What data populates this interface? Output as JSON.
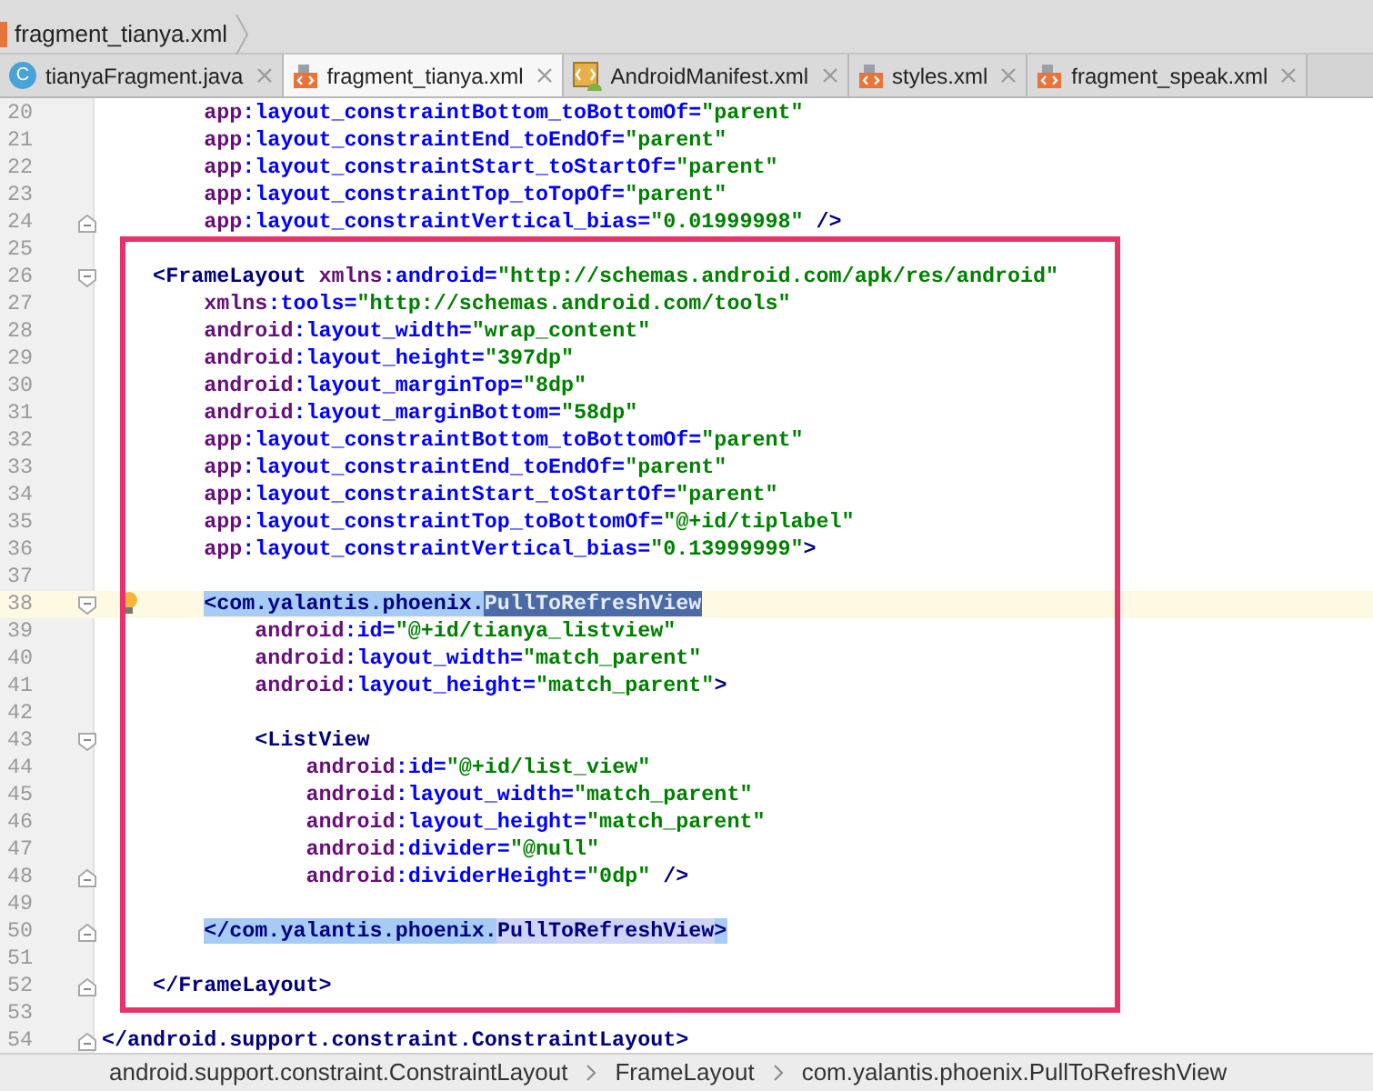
{
  "navigation_bar": {
    "file": "fragment_tianya.xml"
  },
  "tabs": [
    {
      "label": "tianyaFragment.java",
      "kind": "java",
      "icon_letter": "C",
      "selected": false
    },
    {
      "label": "fragment_tianya.xml",
      "kind": "xml",
      "selected": true
    },
    {
      "label": "AndroidManifest.xml",
      "kind": "manifest",
      "selected": false
    },
    {
      "label": "styles.xml",
      "kind": "xml",
      "selected": false
    },
    {
      "label": "fragment_speak.xml",
      "kind": "xml",
      "selected": false
    }
  ],
  "editor": {
    "lines": [
      {
        "number": "20",
        "kind": "plain",
        "current": false,
        "bulb": false,
        "tokens": [
          {
            "kind": "ns",
            "text": "        app"
          },
          {
            "kind": "attr",
            "text": ":layout_constraintBottom_toBottomOf="
          },
          {
            "kind": "value",
            "text": "\"parent\""
          }
        ]
      },
      {
        "number": "21",
        "kind": "plain",
        "current": false,
        "bulb": false,
        "tokens": [
          {
            "kind": "ns",
            "text": "        app"
          },
          {
            "kind": "attr",
            "text": ":layout_constraintEnd_toEndOf="
          },
          {
            "kind": "value",
            "text": "\"parent\""
          }
        ]
      },
      {
        "number": "22",
        "kind": "plain",
        "current": false,
        "bulb": false,
        "tokens": [
          {
            "kind": "ns",
            "text": "        app"
          },
          {
            "kind": "attr",
            "text": ":layout_constraintStart_toStartOf="
          },
          {
            "kind": "value",
            "text": "\"parent\""
          }
        ]
      },
      {
        "number": "23",
        "kind": "plain",
        "current": false,
        "bulb": false,
        "tokens": [
          {
            "kind": "ns",
            "text": "        app"
          },
          {
            "kind": "attr",
            "text": ":layout_constraintTop_toTopOf="
          },
          {
            "kind": "value",
            "text": "\"parent\""
          }
        ]
      },
      {
        "number": "24",
        "kind": "fold_end",
        "current": false,
        "bulb": false,
        "tokens": [
          {
            "kind": "ns",
            "text": "        app"
          },
          {
            "kind": "attr",
            "text": ":layout_constraintVertical_bias="
          },
          {
            "kind": "value",
            "text": "\"0.01999998\""
          },
          {
            "kind": "tag",
            "text": " />"
          }
        ]
      },
      {
        "number": "25",
        "kind": "plain",
        "current": false,
        "bulb": false
      },
      {
        "number": "26",
        "kind": "fold_start",
        "current": false,
        "bulb": false,
        "tokens": [
          {
            "kind": "tag",
            "text": "    <FrameLayout"
          },
          {
            "kind": "ns",
            "text": " xmlns"
          },
          {
            "kind": "attr",
            "text": ":android="
          },
          {
            "kind": "value",
            "text": "\"http://schemas.android.com/apk/res/android\""
          }
        ]
      },
      {
        "number": "27",
        "kind": "plain",
        "current": false,
        "bulb": false,
        "tokens": [
          {
            "kind": "ns",
            "text": "        xmlns"
          },
          {
            "kind": "attr",
            "text": ":tools="
          },
          {
            "kind": "value",
            "text": "\"http://schemas.android.com/tools\""
          }
        ]
      },
      {
        "number": "28",
        "kind": "plain",
        "current": false,
        "bulb": false,
        "tokens": [
          {
            "kind": "ns",
            "text": "        android"
          },
          {
            "kind": "attr",
            "text": ":layout_width="
          },
          {
            "kind": "value",
            "text": "\"wrap_content\""
          }
        ]
      },
      {
        "number": "29",
        "kind": "plain",
        "current": false,
        "bulb": false,
        "tokens": [
          {
            "kind": "ns",
            "text": "        android"
          },
          {
            "kind": "attr",
            "text": ":layout_height="
          },
          {
            "kind": "value",
            "text": "\"397dp\""
          }
        ]
      },
      {
        "number": "30",
        "kind": "plain",
        "current": false,
        "bulb": false,
        "tokens": [
          {
            "kind": "ns",
            "text": "        android"
          },
          {
            "kind": "attr",
            "text": ":layout_marginTop="
          },
          {
            "kind": "value",
            "text": "\"8dp\""
          }
        ]
      },
      {
        "number": "31",
        "kind": "plain",
        "current": false,
        "bulb": false,
        "tokens": [
          {
            "kind": "ns",
            "text": "        android"
          },
          {
            "kind": "attr",
            "text": ":layout_marginBottom="
          },
          {
            "kind": "value",
            "text": "\"58dp\""
          }
        ]
      },
      {
        "number": "32",
        "kind": "plain",
        "current": false,
        "bulb": false,
        "tokens": [
          {
            "kind": "ns",
            "text": "        app"
          },
          {
            "kind": "attr",
            "text": ":layout_constraintBottom_toBottomOf="
          },
          {
            "kind": "value",
            "text": "\"parent\""
          }
        ]
      },
      {
        "number": "33",
        "kind": "plain",
        "current": false,
        "bulb": false,
        "tokens": [
          {
            "kind": "ns",
            "text": "        app"
          },
          {
            "kind": "attr",
            "text": ":layout_constraintEnd_toEndOf="
          },
          {
            "kind": "value",
            "text": "\"parent\""
          }
        ]
      },
      {
        "number": "34",
        "kind": "plain",
        "current": false,
        "bulb": false,
        "tokens": [
          {
            "kind": "ns",
            "text": "        app"
          },
          {
            "kind": "attr",
            "text": ":layout_constraintStart_toStartOf="
          },
          {
            "kind": "value",
            "text": "\"parent\""
          }
        ]
      },
      {
        "number": "35",
        "kind": "plain",
        "current": false,
        "bulb": false,
        "tokens": [
          {
            "kind": "ns",
            "text": "        app"
          },
          {
            "kind": "attr",
            "text": ":layout_constraintTop_toBottomOf="
          },
          {
            "kind": "value",
            "text": "\"@+id/tiplabel\""
          }
        ]
      },
      {
        "number": "36",
        "kind": "plain",
        "current": false,
        "bulb": false,
        "tokens": [
          {
            "kind": "ns",
            "text": "        app"
          },
          {
            "kind": "attr",
            "text": ":layout_constraintVertical_bias="
          },
          {
            "kind": "value",
            "text": "\"0.13999999\""
          },
          {
            "kind": "tag",
            "text": ">"
          }
        ]
      },
      {
        "number": "37",
        "kind": "plain",
        "current": false,
        "bulb": false
      },
      {
        "number": "38",
        "kind": "fold_start",
        "current": true,
        "bulb": true,
        "tokens": [
          {
            "kind": "tag_selected",
            "text": "        <com.yalantis.phoenix."
          },
          {
            "kind": "identifier_caret",
            "text": "PullToRefreshView"
          }
        ]
      },
      {
        "number": "39",
        "kind": "plain",
        "current": false,
        "bulb": false,
        "tokens": [
          {
            "kind": "ns",
            "text": "            android"
          },
          {
            "kind": "attr",
            "text": ":id="
          },
          {
            "kind": "value",
            "text": "\"@+id/tianya_listview\""
          }
        ]
      },
      {
        "number": "40",
        "kind": "plain",
        "current": false,
        "bulb": false,
        "tokens": [
          {
            "kind": "ns",
            "text": "            android"
          },
          {
            "kind": "attr",
            "text": ":layout_width="
          },
          {
            "kind": "value",
            "text": "\"match_parent\""
          }
        ]
      },
      {
        "number": "41",
        "kind": "plain",
        "current": false,
        "bulb": false,
        "tokens": [
          {
            "kind": "ns",
            "text": "            android"
          },
          {
            "kind": "attr",
            "text": ":layout_height="
          },
          {
            "kind": "value",
            "text": "\"match_parent\""
          },
          {
            "kind": "tag",
            "text": ">"
          }
        ]
      },
      {
        "number": "42",
        "kind": "plain",
        "current": false,
        "bulb": false
      },
      {
        "number": "43",
        "kind": "fold_start",
        "current": false,
        "bulb": false,
        "tokens": [
          {
            "kind": "tag",
            "text": "            <ListView"
          }
        ]
      },
      {
        "number": "44",
        "kind": "plain",
        "current": false,
        "bulb": false,
        "tokens": [
          {
            "kind": "ns",
            "text": "                android"
          },
          {
            "kind": "attr",
            "text": ":id="
          },
          {
            "kind": "value",
            "text": "\"@+id/list_view\""
          }
        ]
      },
      {
        "number": "45",
        "kind": "plain",
        "current": false,
        "bulb": false,
        "tokens": [
          {
            "kind": "ns",
            "text": "                android"
          },
          {
            "kind": "attr",
            "text": ":layout_width="
          },
          {
            "kind": "value",
            "text": "\"match_parent\""
          }
        ]
      },
      {
        "number": "46",
        "kind": "plain",
        "current": false,
        "bulb": false,
        "tokens": [
          {
            "kind": "ns",
            "text": "                android"
          },
          {
            "kind": "attr",
            "text": ":layout_height="
          },
          {
            "kind": "value",
            "text": "\"match_parent\""
          }
        ]
      },
      {
        "number": "47",
        "kind": "plain",
        "current": false,
        "bulb": false,
        "tokens": [
          {
            "kind": "ns",
            "text": "                android"
          },
          {
            "kind": "attr",
            "text": ":divider="
          },
          {
            "kind": "value",
            "text": "\"@null\""
          }
        ]
      },
      {
        "number": "48",
        "kind": "fold_end",
        "current": false,
        "bulb": false,
        "tokens": [
          {
            "kind": "ns",
            "text": "                android"
          },
          {
            "kind": "attr",
            "text": ":dividerHeight="
          },
          {
            "kind": "value",
            "text": "\"0dp\""
          },
          {
            "kind": "tag",
            "text": " />"
          }
        ]
      },
      {
        "number": "49",
        "kind": "plain",
        "current": false,
        "bulb": false
      },
      {
        "number": "50",
        "kind": "fold_end",
        "current": false,
        "bulb": false,
        "tokens": [
          {
            "kind": "tag_selected",
            "text": "        </com.yalantis.phoenix."
          },
          {
            "kind": "identifier_usage",
            "text": "PullToRefreshView"
          },
          {
            "kind": "tag_selected",
            "text": ">"
          }
        ]
      },
      {
        "number": "51",
        "kind": "plain",
        "current": false,
        "bulb": false
      },
      {
        "number": "52",
        "kind": "fold_end",
        "current": false,
        "bulb": false,
        "tokens": [
          {
            "kind": "tag",
            "text": "    </FrameLayout>"
          }
        ]
      },
      {
        "number": "53",
        "kind": "plain",
        "current": false,
        "bulb": false
      },
      {
        "number": "54",
        "kind": "fold_end",
        "current": false,
        "bulb": false,
        "tokens": [
          {
            "kind": "tag",
            "text": "</android.support.constraint.ConstraintLayout>"
          }
        ]
      }
    ]
  },
  "breadcrumbs": [
    "android.support.constraint.ConstraintLayout",
    "FrameLayout",
    "com.yalantis.phoenix.PullToRefreshView"
  ]
}
